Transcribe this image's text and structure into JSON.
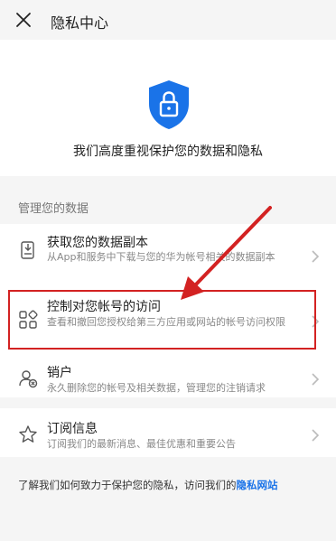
{
  "header": {
    "title": "隐私中心"
  },
  "hero": {
    "text": "我们高度重视保护您的数据和隐私"
  },
  "section": {
    "manage_label": "管理您的数据"
  },
  "items": [
    {
      "title": "获取您的数据副本",
      "desc": "从App和服务中下载与您的华为帐号相关的数据副本"
    },
    {
      "title": "控制对您帐号的访问",
      "desc": "查看和撤回您授权给第三方应用或网站的帐号访问权限"
    },
    {
      "title": "销户",
      "desc": "永久删除您的帐号及相关数据，管理您的注销请求"
    }
  ],
  "subscription": {
    "title": "订阅信息",
    "desc": "订阅我们的最新消息、最佳优惠和重要公告"
  },
  "footer": {
    "text": "了解我们如何致力于保护您的隐私，访问我们的",
    "link": "隐私网站"
  },
  "colors": {
    "accent": "#1a73e8",
    "annotation": "#d32222"
  }
}
